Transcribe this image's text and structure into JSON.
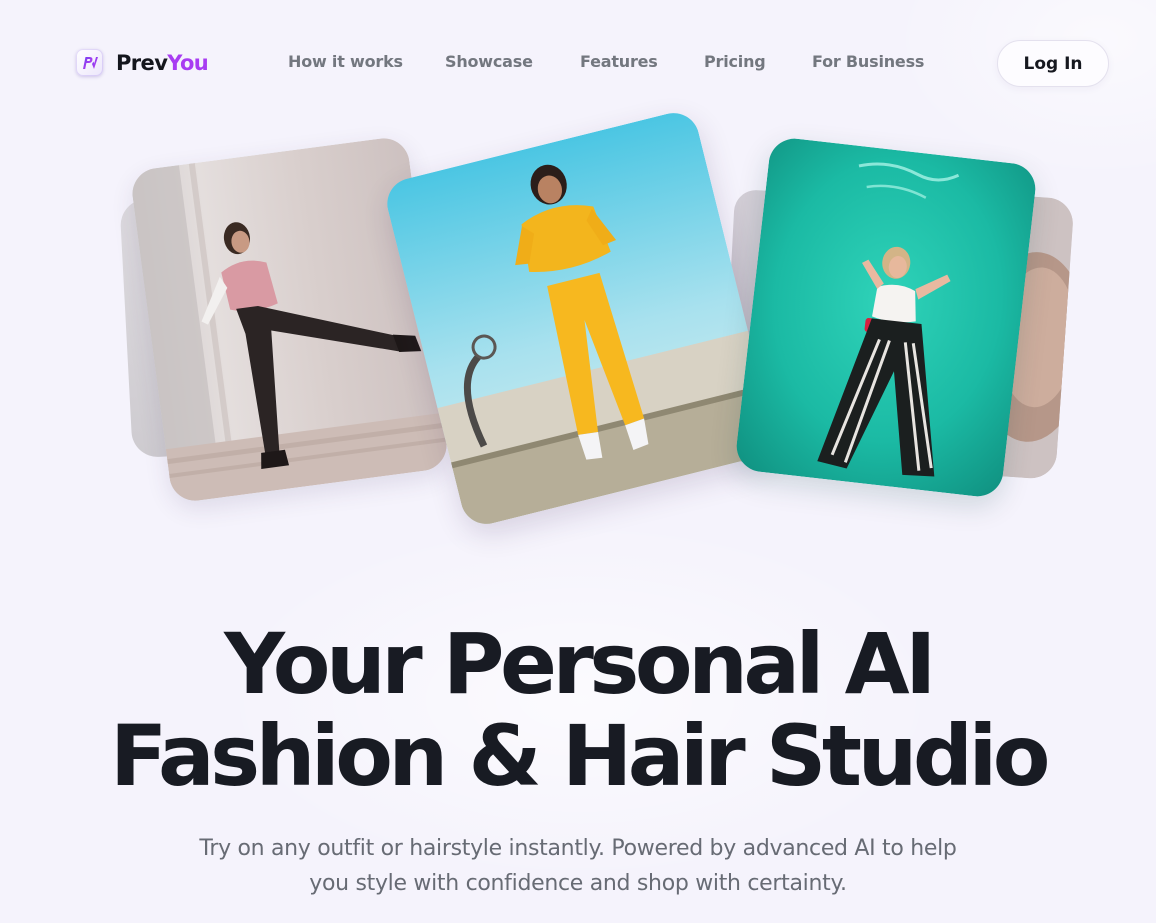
{
  "brand": {
    "name_part1": "Prev",
    "name_part2": "You",
    "accent_color": "#a83cf2"
  },
  "nav": {
    "links": [
      {
        "label": "How it works"
      },
      {
        "label": "Showcase"
      },
      {
        "label": "Features"
      },
      {
        "label": "Pricing"
      },
      {
        "label": "For Business"
      }
    ],
    "login_label": "Log In"
  },
  "gallery": {
    "cards": [
      {
        "subject": "woman in pink shirt kicking",
        "background": "beige-wall"
      },
      {
        "subject": "woman in yellow sweatsuit",
        "background": "blue-sky-basketball-court"
      },
      {
        "subject": "woman in striped trousers",
        "background": "teal-neon-wall"
      }
    ]
  },
  "hero": {
    "title_line1": "Your Personal AI",
    "title_line2": "Fashion & Hair Studio",
    "subtitle_line1": "Try on any outfit or hairstyle instantly. Powered by advanced AI to help",
    "subtitle_line2": "you style with confidence and shop with certainty."
  }
}
